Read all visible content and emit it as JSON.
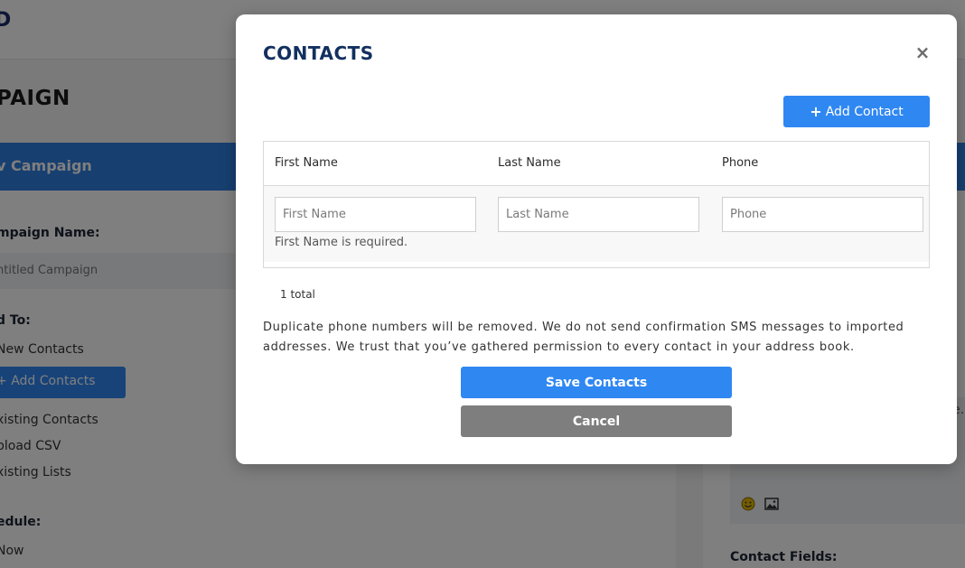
{
  "background": {
    "logo": "D",
    "page_title": "PAIGN",
    "section_header": "v Campaign",
    "campaign_name_label": "mpaign Name:",
    "campaign_name_value": "ntitled Campaign",
    "send_to_label": "d To:",
    "options": [
      "New Contacts",
      "xisting Contacts",
      "pload CSV",
      "xisting Lists"
    ],
    "add_contacts_button": "Add Contacts",
    "schedule_label": "edule:",
    "schedule_value": "Now",
    "contact_fields_label": "Contact Fields:",
    "ellipsis": "e."
  },
  "modal": {
    "title": "CONTACTS",
    "close_glyph": "×",
    "add_contact_button": "Add Contact",
    "table": {
      "headers": [
        "First Name",
        "Last Name",
        "Phone"
      ],
      "row": {
        "first_name": {
          "value": "",
          "placeholder": "First Name"
        },
        "last_name": {
          "value": "",
          "placeholder": "Last Name"
        },
        "phone": {
          "value": "",
          "placeholder": "Phone"
        }
      },
      "error": "First Name is required."
    },
    "total": "1 total",
    "notice": "Duplicate phone numbers will be removed. We do not send confirmation SMS messages to imported addresses. We trust that you’ve gathered permission to every contact in your address book.",
    "save_button": "Save Contacts",
    "cancel_button": "Cancel"
  }
}
